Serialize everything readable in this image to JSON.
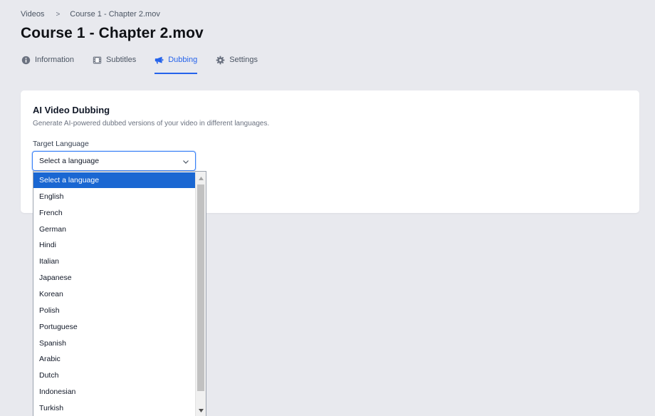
{
  "breadcrumb": {
    "root": "Videos",
    "separator": ">",
    "current": "Course 1 - Chapter 2.mov"
  },
  "page_title": "Course 1 - Chapter 2.mov",
  "tabs": [
    {
      "label": "Information",
      "icon": "info-icon"
    },
    {
      "label": "Subtitles",
      "icon": "film-icon"
    },
    {
      "label": "Dubbing",
      "icon": "megaphone-icon",
      "active": true
    },
    {
      "label": "Settings",
      "icon": "gear-icon"
    }
  ],
  "card": {
    "title": "AI Video Dubbing",
    "description": "Generate AI-powered dubbed versions of your video in different languages.",
    "field_label": "Target Language",
    "select_value": "Select a language"
  },
  "dropdown": {
    "options": [
      "Select a language",
      "English",
      "French",
      "German",
      "Hindi",
      "Italian",
      "Japanese",
      "Korean",
      "Polish",
      "Portuguese",
      "Spanish",
      "Arabic",
      "Dutch",
      "Indonesian",
      "Turkish"
    ],
    "selected_index": 0
  },
  "colors": {
    "accent": "#2563eb",
    "selected_option": "#1a67d2",
    "background": "#e8e9ee"
  }
}
